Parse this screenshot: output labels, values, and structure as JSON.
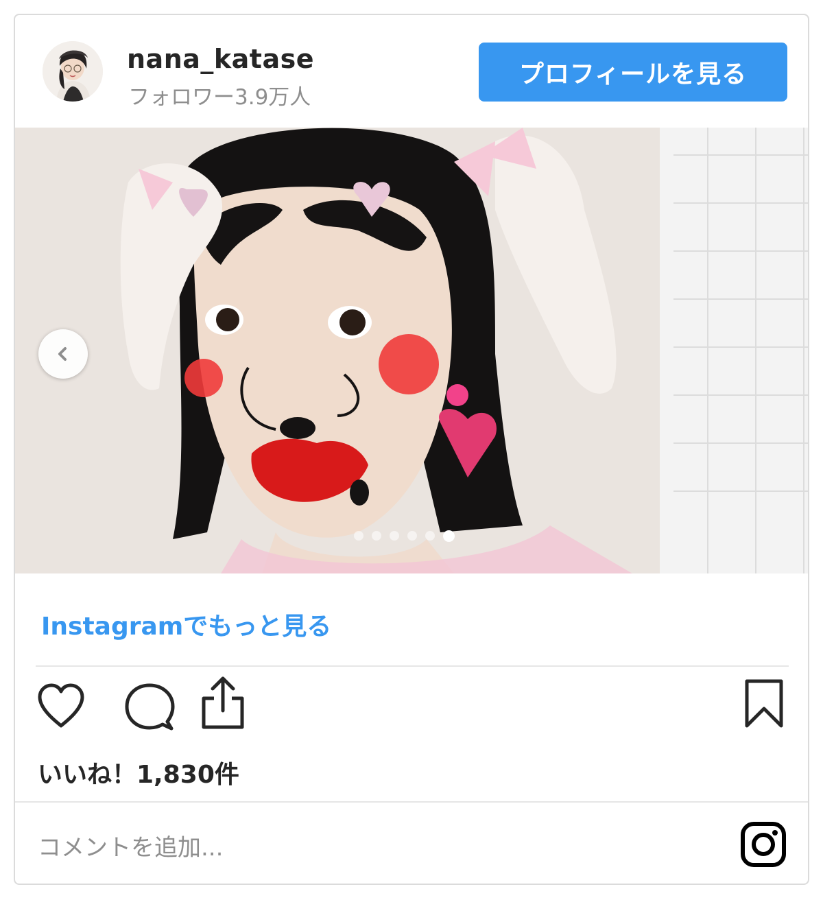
{
  "header": {
    "username": "nana_katase",
    "followers": "フォロワー3.9万人",
    "profile_button": "プロフィールを見る"
  },
  "post": {
    "carousel": {
      "total_slides": 6,
      "current_slide": 6,
      "prev_icon": "chevron-left-icon"
    },
    "more_link": "Instagramでもっと見る",
    "likes": "いいね！1,830件",
    "comment_placeholder": "コメントを追加..."
  },
  "icons": {
    "like": "heart-icon",
    "comment": "comment-bubble-icon",
    "share": "share-icon",
    "save": "bookmark-icon",
    "brand": "instagram-icon"
  },
  "colors": {
    "accent": "#3897f0",
    "text": "#262626",
    "muted": "#8e8e8e",
    "border": "#dbdbdb"
  }
}
